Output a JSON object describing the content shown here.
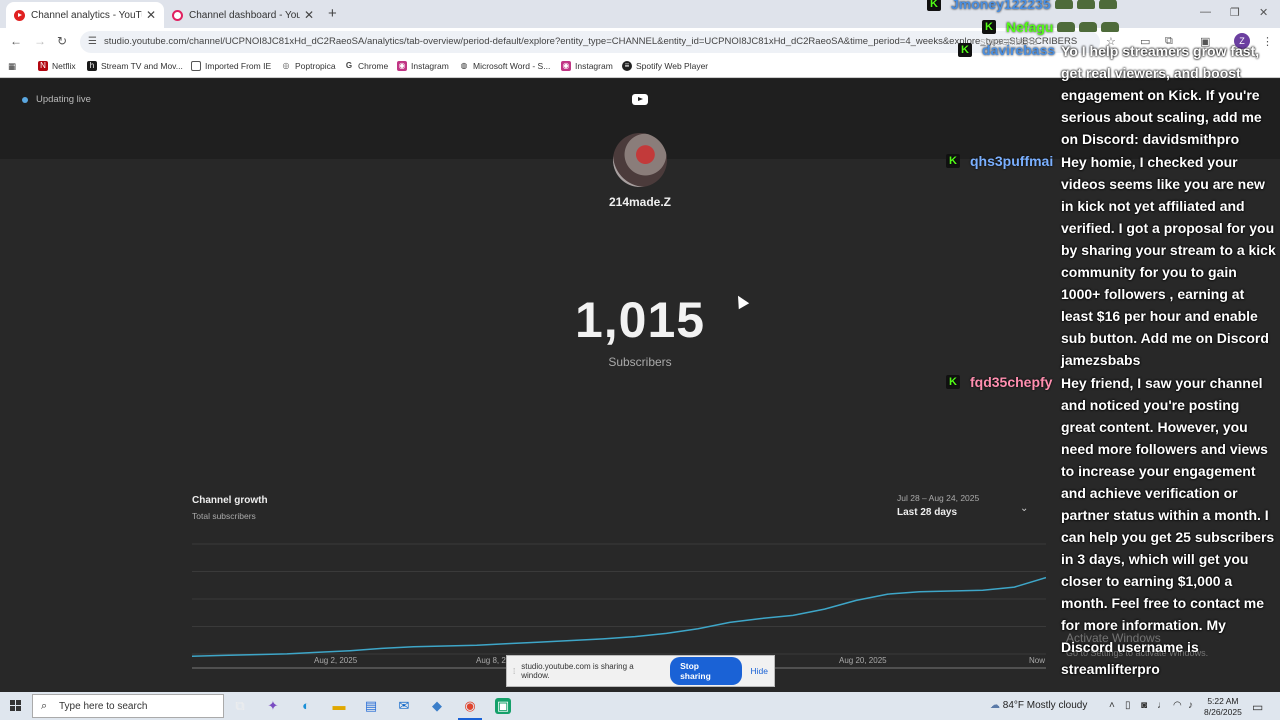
{
  "browser": {
    "tabs": [
      {
        "title": "Channel analytics - YouTube St",
        "active": true
      },
      {
        "title": "Channel dashboard - YouTube",
        "active": false
      }
    ],
    "url": "studio.youtube.com/channel/UCPNOI8JC81xHd_dC2RaeoSA/analytics/tab-overview/period-default/explore?entity_type=CHANNEL&entity_id=UCPNOI8JC81xHd_dC2RaeoSA&time_period=4_weeks&explore_type=SUBSCRIBERS",
    "profile_initial": "Z",
    "bookmarks": [
      "Netflix",
      "Stream TV and Mov...",
      "Imported From IE",
      "Poptropica",
      "Chrome",
      "Instagram",
      "Microsoft Word - S...",
      "Instagram",
      "Spotify Web Player"
    ]
  },
  "studio": {
    "status": "Updating live",
    "channel_name": "214made.Z",
    "subscriber_count": "1,015",
    "subscriber_label": "Subscribers",
    "growth_title": "Channel growth",
    "growth_subtitle": "Total subscribers",
    "date_range": "Jul 28 – Aug 24, 2025",
    "range_label": "Last 28 days",
    "x_labels": [
      "Aug 2, 2025",
      "Aug 8, 2",
      "Aug 20, 2025",
      "Now"
    ]
  },
  "chart_data": {
    "type": "line",
    "title": "Channel growth",
    "subtitle": "Total subscribers",
    "x": [
      "Jul 28",
      "Jul 29",
      "Jul 30",
      "Jul 31",
      "Aug 1",
      "Aug 2",
      "Aug 3",
      "Aug 4",
      "Aug 5",
      "Aug 6",
      "Aug 7",
      "Aug 8",
      "Aug 9",
      "Aug 10",
      "Aug 11",
      "Aug 12",
      "Aug 13",
      "Aug 14",
      "Aug 15",
      "Aug 16",
      "Aug 17",
      "Aug 18",
      "Aug 19",
      "Aug 20",
      "Aug 21",
      "Aug 22",
      "Aug 23",
      "Aug 24"
    ],
    "values": [
      915,
      916,
      917,
      918,
      920,
      922,
      925,
      927,
      928,
      929,
      931,
      933,
      935,
      937,
      940,
      944,
      950,
      958,
      963,
      967,
      975,
      986,
      994,
      997,
      998,
      999,
      1003,
      1015
    ],
    "ylim": [
      900,
      1040
    ],
    "grid": true
  },
  "share_bar": {
    "message": "studio.youtube.com is sharing a window.",
    "stop_label": "Stop sharing",
    "hide_label": "Hide"
  },
  "chat": {
    "top_users": [
      {
        "name": "Jmoney122235",
        "color": "#4b8fe0"
      },
      {
        "name": "Nefagu",
        "color": "#53fc18"
      },
      {
        "name": "davirebass",
        "color": "#4b8fe0"
      }
    ],
    "subscribers_overlay": "SUBSCRIBERS",
    "messages": [
      {
        "user": "",
        "text": "Yo I help streamers grow fast, get real viewers, and boost engagement on Kick. If you're serious about scaling, add me on Discord: davidsmithpro"
      },
      {
        "user": "qhs3puffmai",
        "color": "#7bb0ff",
        "text": "Hey homie, I checked your videos seems like you are new in kick not yet affiliated and verified. I got a proposal for you by sharing your stream to a kick community for you to gain 1000+ followers , earning at least $16 per hour and enable sub button. Add me on Discord jamezsbabs"
      },
      {
        "user": "fqd35chepfy",
        "color": "#ff8fb0",
        "text": "Hey friend, I saw your channel and noticed you're posting great content. However, you need more followers and views to increase your engagement and achieve verification or partner status within a month. I can help you get 25 subscribers in 3 days, which will get you closer to earning $1,000 a month. Feel free to contact me for more information. My Discord username is streamlifterpro"
      }
    ],
    "watermark_title": "Activate Windows",
    "watermark_sub": "Go to Settings to activate Windows."
  },
  "taskbar": {
    "search_placeholder": "Type here to search",
    "weather": "84°F  Mostly cloudy",
    "time": "5:22 AM",
    "date": "8/26/2025"
  }
}
